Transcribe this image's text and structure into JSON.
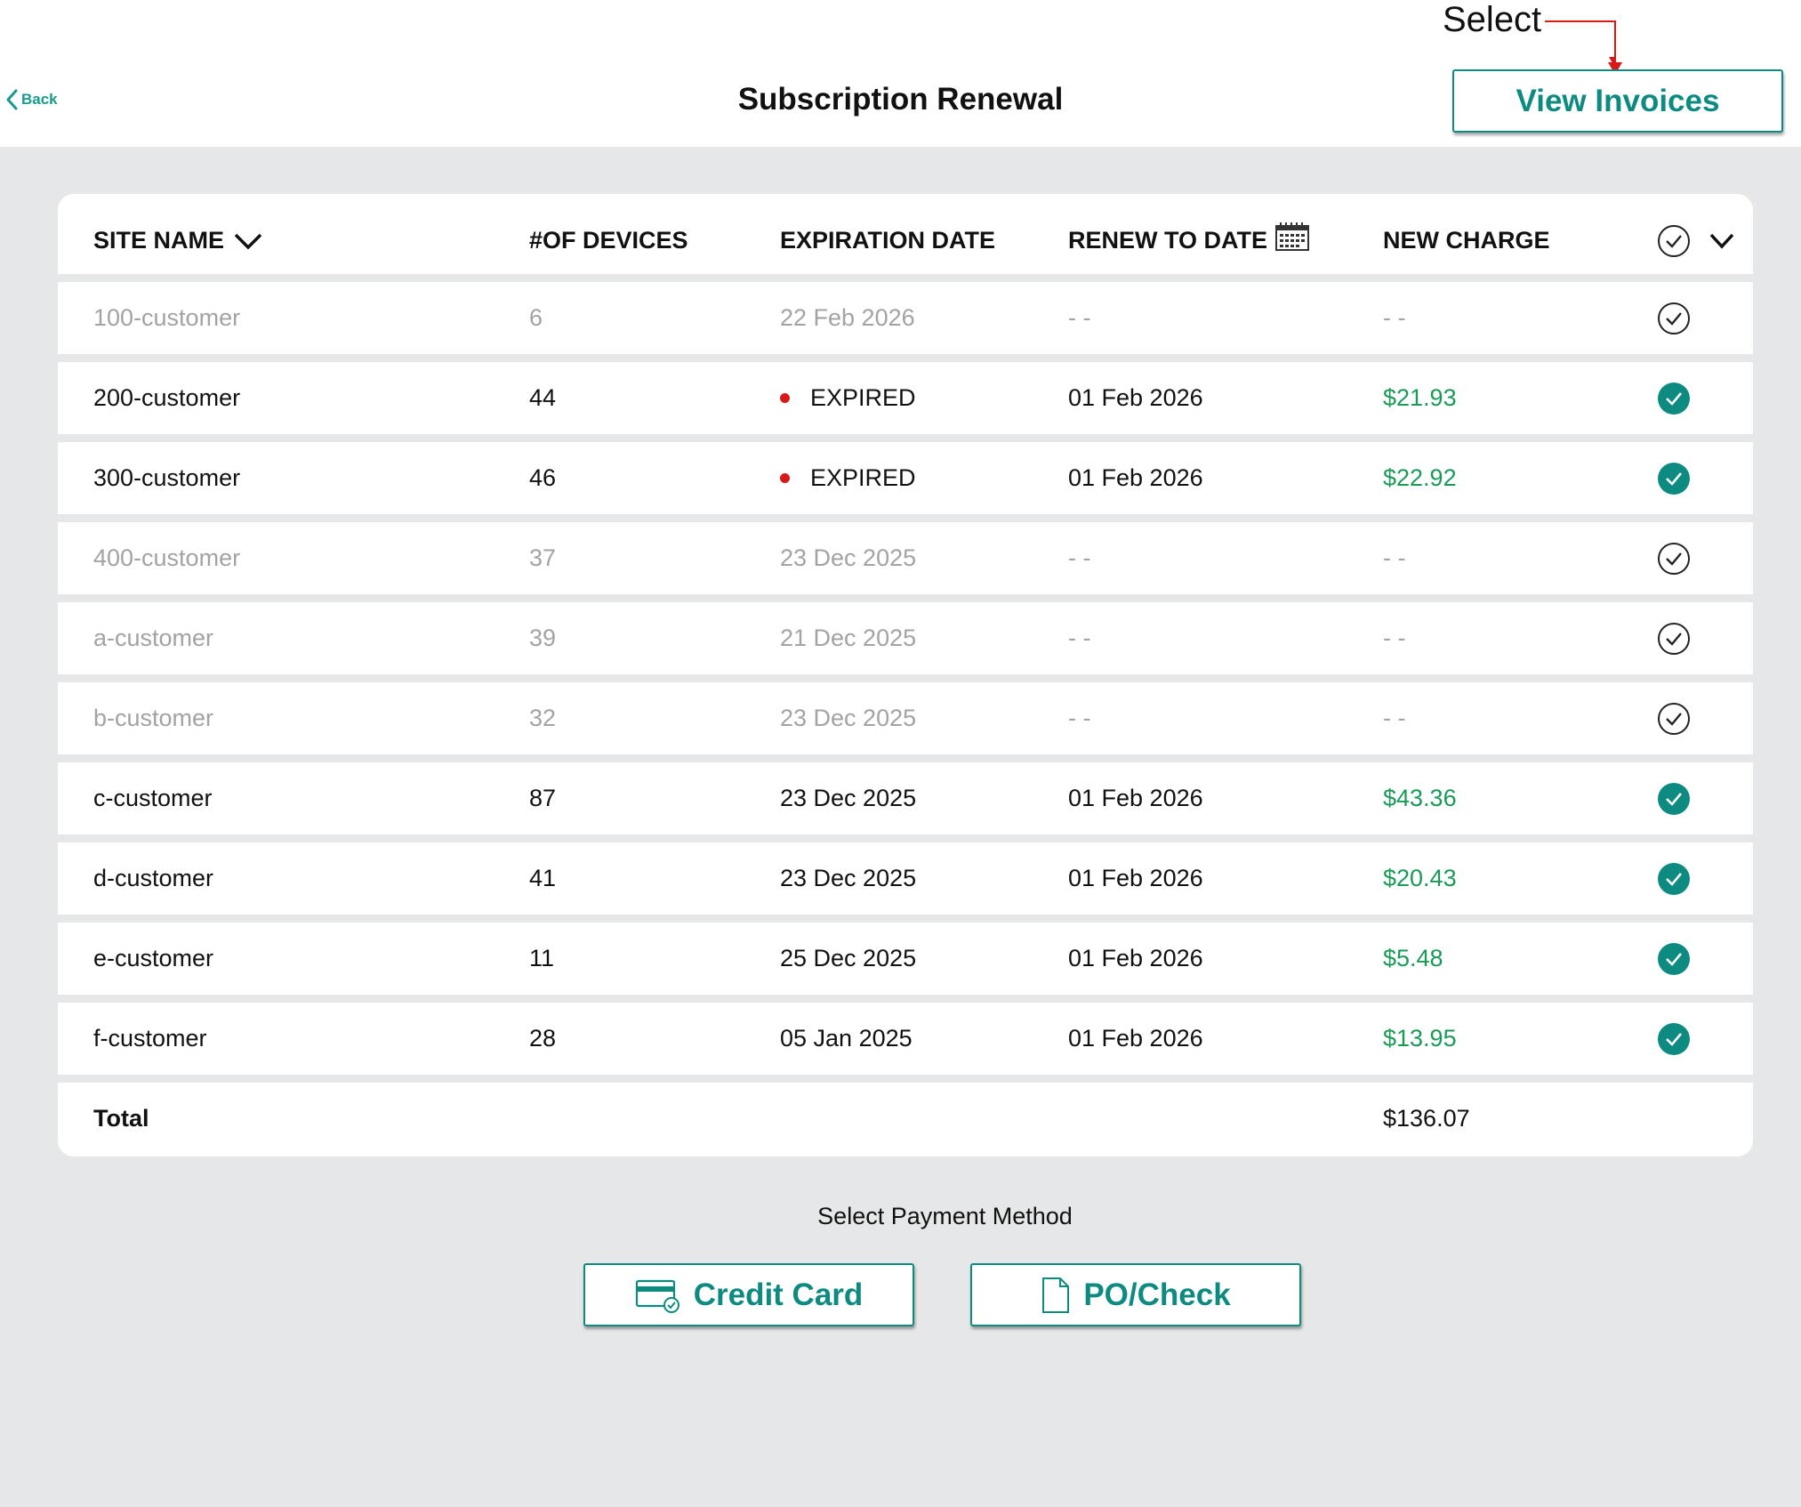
{
  "header": {
    "back_label": "Back",
    "title": "Subscription Renewal",
    "view_invoices_label": "View Invoices"
  },
  "annotation": {
    "label": "Select",
    "color": "#d91818"
  },
  "table": {
    "columns": [
      "SITE NAME",
      "#OF DEVICES",
      "EXPIRATION DATE",
      "RENEW TO DATE",
      "NEW CHARGE"
    ],
    "rows": [
      {
        "site": "100-customer",
        "devices": "6",
        "expiration": "22 Feb 2026",
        "expired": false,
        "renew": "- -",
        "charge": "- -",
        "selected": false
      },
      {
        "site": "200-customer",
        "devices": "44",
        "expiration": "EXPIRED",
        "expired": true,
        "renew": "01 Feb 2026",
        "charge": "$21.93",
        "selected": true
      },
      {
        "site": "300-customer",
        "devices": "46",
        "expiration": "EXPIRED",
        "expired": true,
        "renew": "01 Feb 2026",
        "charge": "$22.92",
        "selected": true
      },
      {
        "site": "400-customer",
        "devices": "37",
        "expiration": "23 Dec 2025",
        "expired": false,
        "renew": "- -",
        "charge": "- -",
        "selected": false
      },
      {
        "site": "a-customer",
        "devices": "39",
        "expiration": "21 Dec 2025",
        "expired": false,
        "renew": "- -",
        "charge": "- -",
        "selected": false
      },
      {
        "site": "b-customer",
        "devices": "32",
        "expiration": "23 Dec 2025",
        "expired": false,
        "renew": "- -",
        "charge": "- -",
        "selected": false
      },
      {
        "site": "c-customer",
        "devices": "87",
        "expiration": "23 Dec 2025",
        "expired": false,
        "renew": "01 Feb 2026",
        "charge": "$43.36",
        "selected": true
      },
      {
        "site": "d-customer",
        "devices": "41",
        "expiration": "23 Dec 2025",
        "expired": false,
        "renew": "01 Feb 2026",
        "charge": "$20.43",
        "selected": true
      },
      {
        "site": "e-customer",
        "devices": "11",
        "expiration": "25 Dec 2025",
        "expired": false,
        "renew": "01 Feb 2026",
        "charge": "$5.48",
        "selected": true
      },
      {
        "site": "f-customer",
        "devices": "28",
        "expiration": "05 Jan 2025",
        "expired": false,
        "renew": "01 Feb 2026",
        "charge": "$13.95",
        "selected": true
      }
    ],
    "total_label": "Total",
    "total_value": "$136.07"
  },
  "payment": {
    "label": "Select Payment Method",
    "credit_card_label": "Credit Card",
    "po_check_label": "PO/Check"
  },
  "colors": {
    "accent": "#0d8b80",
    "charge_green": "#1a9a57",
    "expired_red": "#d91818",
    "background": "#e6e7e8"
  }
}
